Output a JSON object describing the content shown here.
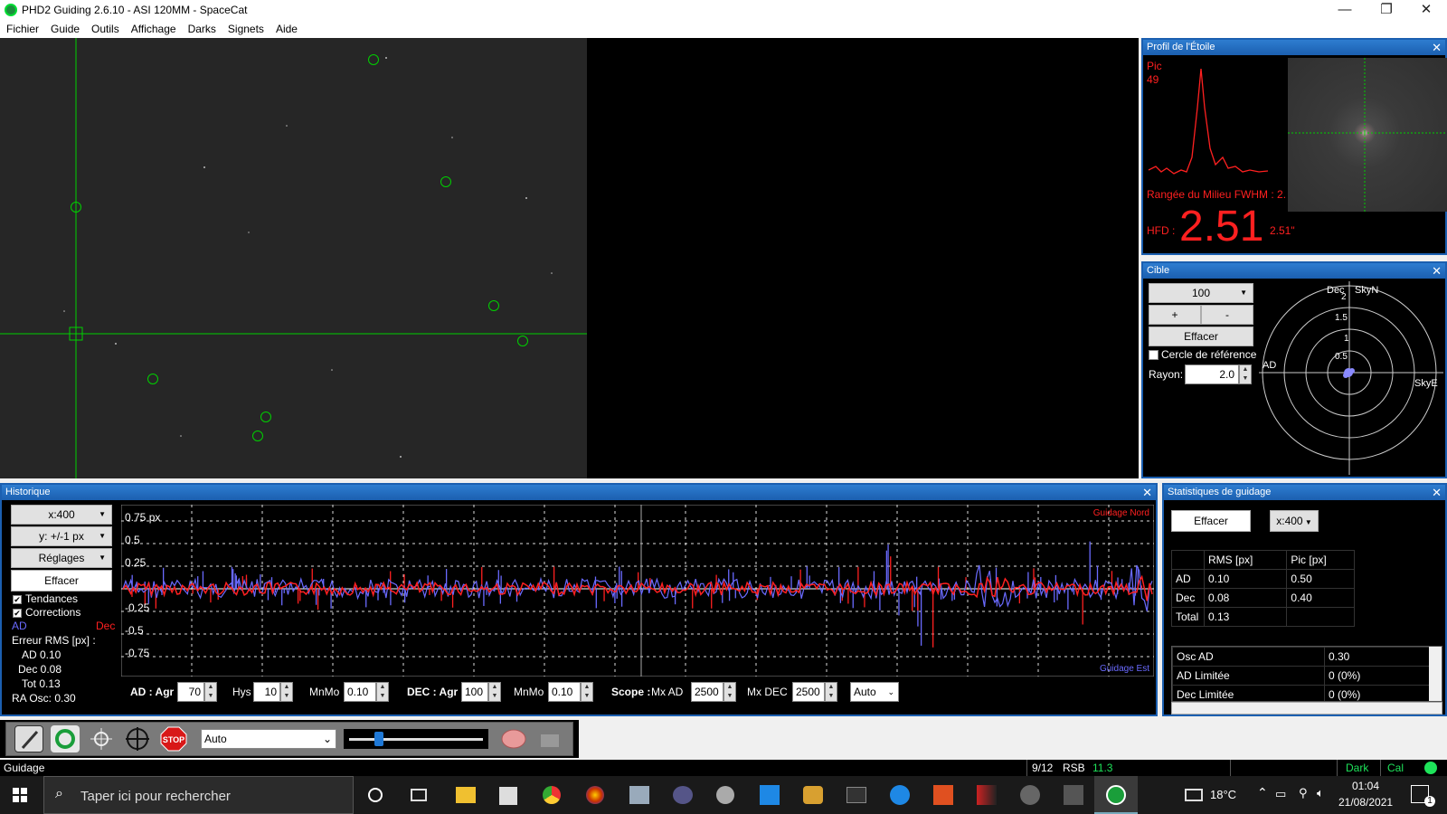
{
  "window": {
    "title": "PHD2 Guiding 2.6.10 - ASI 120MM - SpaceCat",
    "min": "—",
    "max": "❐",
    "close": "✕"
  },
  "menu": [
    "Fichier",
    "Guide",
    "Outils",
    "Affichage",
    "Darks",
    "Signets",
    "Aide"
  ],
  "profile": {
    "title": "Profil de l'Étoile",
    "pic_label": "Pic",
    "pic_value": "49",
    "mid_label": "Rangée du Milieu FWHM : 2.",
    "hfd_label": "HFD :",
    "hfd_value": "2.51",
    "hfd_arcsec": "2.51\""
  },
  "cible": {
    "title": "Cible",
    "scale": "100",
    "plus": "+",
    "minus": "-",
    "clear": "Effacer",
    "ref_circle": "Cercle de référence",
    "radius_label": "Rayon:",
    "radius_value": "2.0",
    "dec_label": "Dec",
    "skyn": "SkyN",
    "skye": "SkyE",
    "ad_label": "AD",
    "ring_labels": [
      "2",
      "1.5",
      "1",
      "0.5"
    ]
  },
  "history": {
    "title": "Historique",
    "xscale": "x:400",
    "yscale": "y: +/-1 px",
    "settings": "Réglages",
    "clear": "Effacer",
    "trends": "Tendances",
    "corrections": "Corrections",
    "ad": "AD",
    "dec": "Dec",
    "rms_title": "Erreur RMS [px] :",
    "rms_ad": "AD 0.10",
    "rms_dec": "Dec 0.08",
    "rms_tot": "Tot 0.13",
    "ra_osc": "RA Osc: 0.30",
    "north": "Guidage Nord",
    "east": "Guidage Est",
    "yticks": [
      "0.75 px",
      "0.5",
      "0.25",
      "-0.25",
      "-0.5",
      "-0.75"
    ],
    "controls": {
      "ad_agr_label": "AD : Agr",
      "ad_agr": "70",
      "hys_label": "Hys",
      "hys": "10",
      "mnmo_label": "MnMo",
      "mnmo": "0.10",
      "dec_agr_label": "DEC : Agr",
      "dec_agr": "100",
      "mnmo2_label": "MnMo",
      "mnmo2": "0.10",
      "scope_label": "Scope :",
      "mxad_label": "Mx AD",
      "mxad": "2500",
      "mxdec_label": "Mx DEC",
      "mxdec": "2500",
      "mode": "Auto"
    }
  },
  "stats": {
    "title": "Statistiques de guidage",
    "clear": "Effacer",
    "xscale": "x:400",
    "headers": [
      "",
      "RMS [px]",
      "Pic [px]"
    ],
    "rows": [
      [
        "AD",
        "0.10",
        "0.50"
      ],
      [
        "Dec",
        "0.08",
        "0.40"
      ],
      [
        "Total",
        "0.13",
        ""
      ]
    ],
    "rows2": [
      [
        "Osc AD",
        "0.30"
      ],
      [
        "AD Limitée",
        "0 (0%)"
      ],
      [
        "Dec Limitée",
        "0 (0%)"
      ]
    ]
  },
  "toolbar": {
    "exposure": "Auto"
  },
  "status": {
    "left": "Guidage",
    "frames": "9/12",
    "snr_label": "RSB",
    "snr": "11.3",
    "dark": "Dark",
    "cal": "Cal"
  },
  "taskbar": {
    "search": "Taper ici pour rechercher",
    "temp": "18°C",
    "time": "01:04",
    "date": "21/08/2021",
    "notif": "1"
  },
  "colors": {
    "ra": "#6a6aff",
    "dec": "#ff2020",
    "accent": "#1b5fb0",
    "grid": "#00d000"
  }
}
